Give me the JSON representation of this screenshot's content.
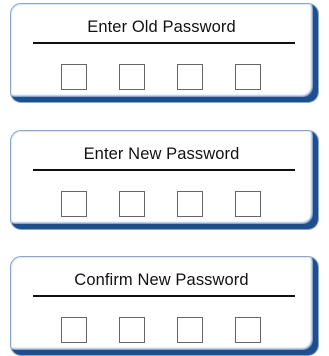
{
  "panels": [
    {
      "title": "Enter Old Password",
      "digit_count": 4
    },
    {
      "title": "Enter New Password",
      "digit_count": 4
    },
    {
      "title": "Confirm New Password",
      "digit_count": 4
    }
  ],
  "colors": {
    "panel_border_shadow": "#1f4e8c",
    "text": "#111111",
    "box_border": "#666666"
  }
}
